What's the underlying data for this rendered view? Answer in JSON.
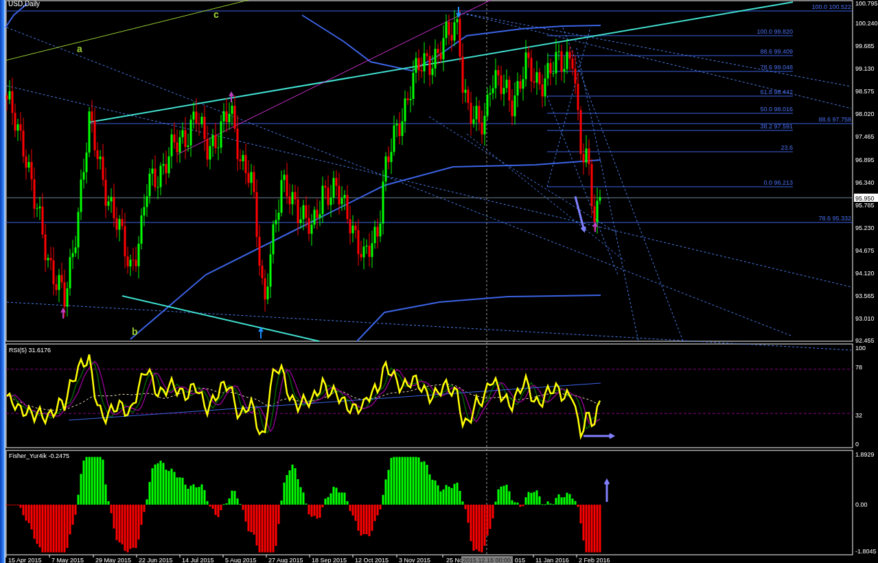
{
  "window": {
    "title": "USD,Daily"
  },
  "price_panel": {
    "axis_labels": [
      "100.795",
      "100.240",
      "99.685",
      "99.130",
      "98.575",
      "98.020",
      "97.465",
      "96.895",
      "96.340",
      "95.785",
      "95.230",
      "94.675",
      "94.120",
      "93.565",
      "93.010",
      "92.455"
    ],
    "current_price": "95.950",
    "fib_labels": [
      "100.0 100.522",
      "100.0 99.820",
      "88.6 99.409",
      "78.6 99.048",
      "61.8 98.442",
      "50.0 98.016",
      "88.6 97.758",
      "38.2 97.591",
      "23.6",
      "0.0 96.213",
      "78.6 95.332"
    ],
    "wave_labels": [
      "a",
      "b",
      "c"
    ]
  },
  "rsi_panel": {
    "title": "RSI(5) 31.6176",
    "axis_labels": [
      "100",
      "78",
      "32",
      "0"
    ]
  },
  "fisher_panel": {
    "title": "Fisher_Yur4ik -0.2475",
    "axis_labels": [
      "1.8929",
      "0.00",
      "-1.8045"
    ]
  },
  "time_axis": {
    "labels": [
      "15 Apr 2015",
      "7 May 2015",
      "29 May 2015",
      "22 Jun 2015",
      "14 Jul 2015",
      "5 Aug 2015",
      "27 Aug 2015",
      "18 Sep 2015",
      "12 Oct 2015",
      "3 Nov 2015",
      "25 No",
      "015",
      "11 Jan 2016",
      "2 Feb 2016"
    ],
    "crosshair_time": "2015.12.16 00:00"
  }
}
